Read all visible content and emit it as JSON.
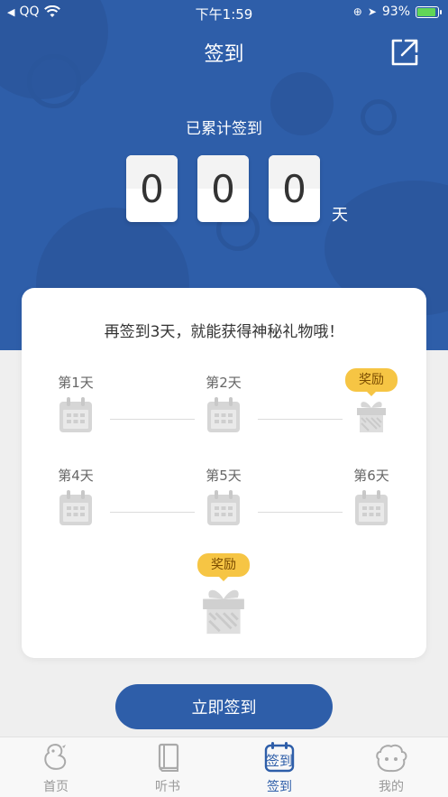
{
  "status_bar": {
    "back_app": "QQ",
    "time": "下午1:59",
    "battery": "93%",
    "battery_level": 0.93
  },
  "header": {
    "title": "签到",
    "share_icon": "share-icon"
  },
  "streak": {
    "label": "已累计签到",
    "digits": [
      "0",
      "0",
      "0"
    ],
    "unit": "天"
  },
  "card": {
    "heading": "再签到3天，就能获得神秘礼物哦！",
    "days": [
      {
        "label": "第1天",
        "icon": "calendar-icon"
      },
      {
        "label": "第2天",
        "icon": "calendar-icon"
      },
      {
        "label": "奖励",
        "icon": "gift-icon"
      },
      {
        "label": "第4天",
        "icon": "calendar-icon"
      },
      {
        "label": "第5天",
        "icon": "calendar-icon"
      },
      {
        "label": "第6天",
        "icon": "calendar-icon"
      }
    ],
    "final_reward": {
      "label": "奖励",
      "icon": "gift-icon"
    }
  },
  "checkin_button": "立即签到",
  "tabs": [
    {
      "label": "首页",
      "icon": "home-icon",
      "active": false
    },
    {
      "label": "听书",
      "icon": "book-icon",
      "active": false
    },
    {
      "label": "签到",
      "icon": "checkin-icon",
      "active": true
    },
    {
      "label": "我的",
      "icon": "profile-icon",
      "active": false
    }
  ],
  "colors": {
    "primary": "#2e5ea9",
    "badge": "#f6c544",
    "icon_gray": "#d6d6d6"
  }
}
